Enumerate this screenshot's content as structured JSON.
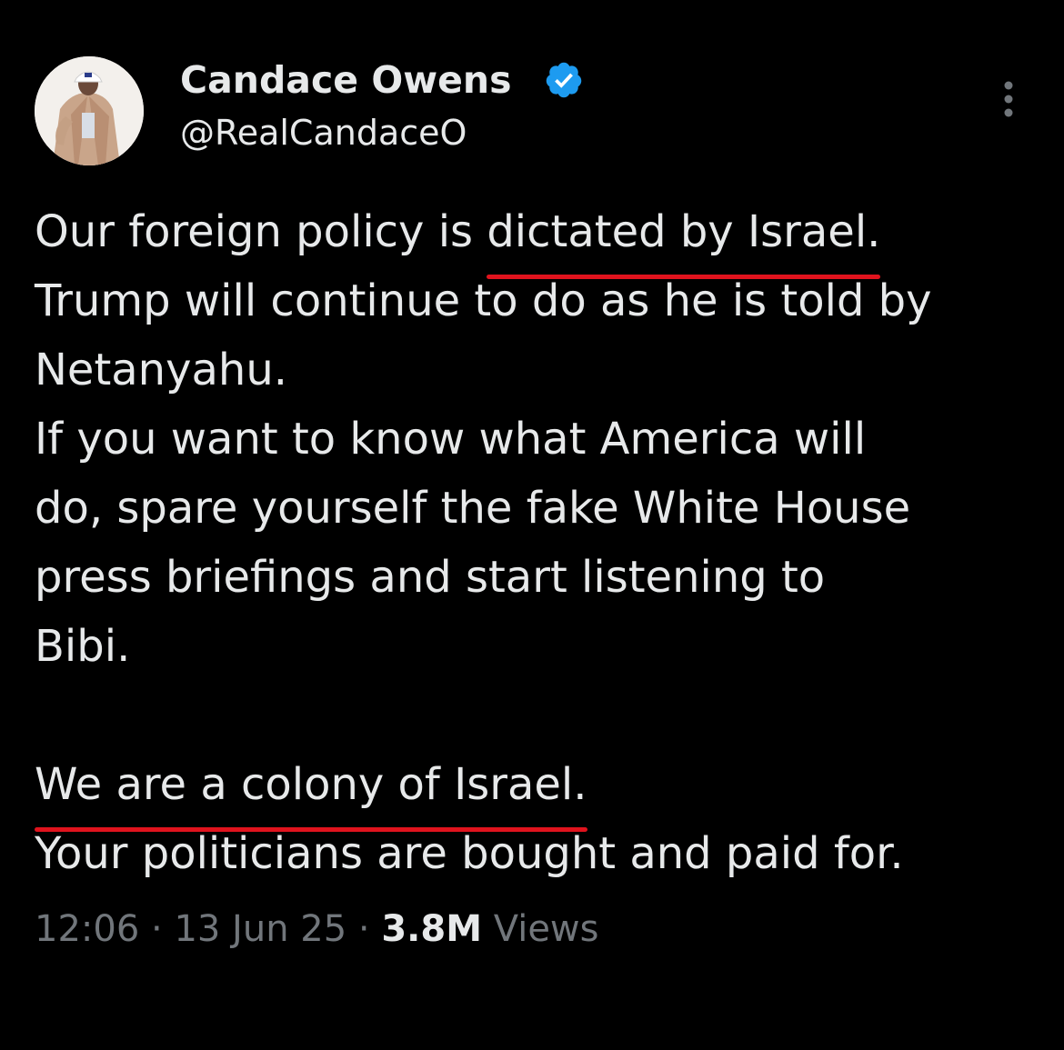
{
  "author": {
    "display_name": "Candace Owens",
    "handle": "@RealCandaceO",
    "verified_color": "#1d9bf0"
  },
  "tweet": {
    "line1_before": "Our foreign policy is ",
    "line1_highlight": "dictated by Israel.",
    "line2": "Trump will continue to do as he is told by",
    "line3": "Netanyahu.",
    "line4": "If you want to know what America will",
    "line5": "do, spare yourself the fake White House",
    "line6": "press briefings and start listening to",
    "line7": "Bibi.",
    "line9_highlight": "We are a colony of Israel.",
    "line10": "Your politicians are bought and paid for."
  },
  "highlight_color": "#e0131d",
  "meta": {
    "time": "12:06",
    "separator": " · ",
    "date": "13 Jun 25",
    "views_count": "3.8M",
    "views_label": "Views"
  },
  "icons": {
    "verified": "verified-badge-icon",
    "more": "more-vertical-icon"
  }
}
